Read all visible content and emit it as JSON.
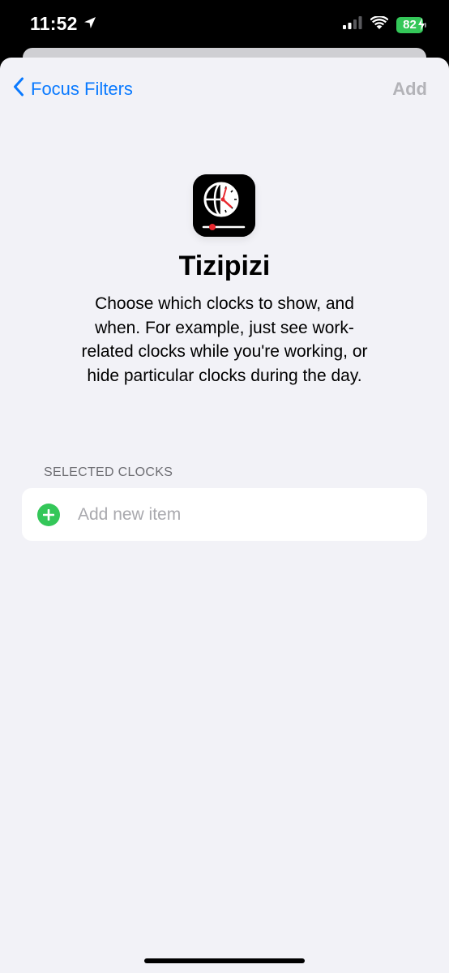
{
  "status_bar": {
    "time": "11:52",
    "battery_level": "82",
    "location_icon": "location-arrow-icon",
    "cellular_icon": "cellular-signal-icon",
    "wifi_icon": "wifi-icon",
    "battery_color": "#34c759"
  },
  "nav": {
    "back_label": "Focus Filters",
    "action_label": "Add",
    "back_icon": "chevron-left-icon",
    "accent": "#0a7aff"
  },
  "app": {
    "name": "Tizipizi",
    "icon": "globe-clock-icon",
    "description": "Choose which clocks to show, and when. For example, just see work-related clocks while you're working, or hide particular clocks during the day."
  },
  "section": {
    "header": "SELECTED CLOCKS",
    "add_item_placeholder": "Add new item",
    "add_icon": "plus-circle-icon"
  }
}
